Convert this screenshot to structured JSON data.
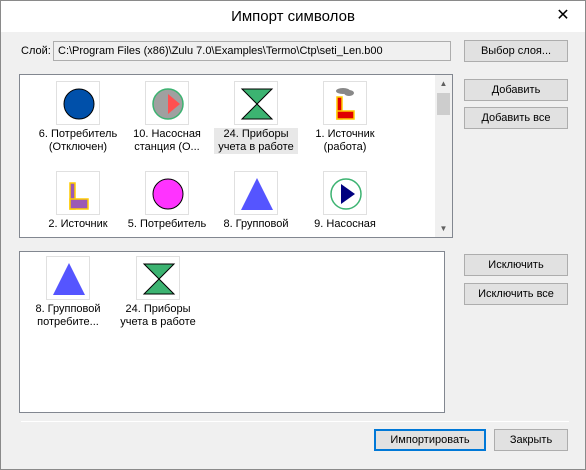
{
  "dialog": {
    "title": "Импорт символов",
    "close_icon": "close-icon"
  },
  "layer": {
    "label": "Слой:",
    "path": "C:\\Program Files (x86)\\Zulu 7.0\\Examples\\Termo\\Ctp\\seti_Len.b00",
    "choose_button": "Выбор слоя..."
  },
  "available": {
    "items": [
      {
        "label": "6. Потребитель\n(Отключен)",
        "icon": "blue-circle-icon"
      },
      {
        "label": "10. Насосная\nстанция (О...",
        "icon": "pump-station-icon"
      },
      {
        "label": "24. Приборы\nучета в работе",
        "icon": "hourglass-meter-icon"
      },
      {
        "label": "1. Источник\n(работа)",
        "icon": "source-working-icon"
      },
      {
        "label": "2. Источник",
        "icon": "source-icon"
      },
      {
        "label": "5. Потребитель",
        "icon": "magenta-circle-icon"
      },
      {
        "label": "8. Групповой",
        "icon": "blue-triangle-icon"
      },
      {
        "label": "9. Насосная",
        "icon": "pump-icon"
      }
    ]
  },
  "actions": {
    "add": "Добавить",
    "add_all": "Добавить все",
    "remove": "Исключить",
    "remove_all": "Исключить все"
  },
  "selected": {
    "items": [
      {
        "label": "8. Групповой\nпотребите...",
        "icon": "blue-triangle-icon"
      },
      {
        "label": "24. Приборы\nучета в работе",
        "icon": "hourglass-meter-icon"
      }
    ]
  },
  "footer": {
    "import": "Импортировать",
    "close": "Закрыть"
  },
  "colors": {
    "accent": "#0078d7",
    "hourglass": "#3cb371",
    "triangle": "#5555ff",
    "circle_blue": "#0050aa",
    "circle_magenta": "#ff33ff"
  }
}
